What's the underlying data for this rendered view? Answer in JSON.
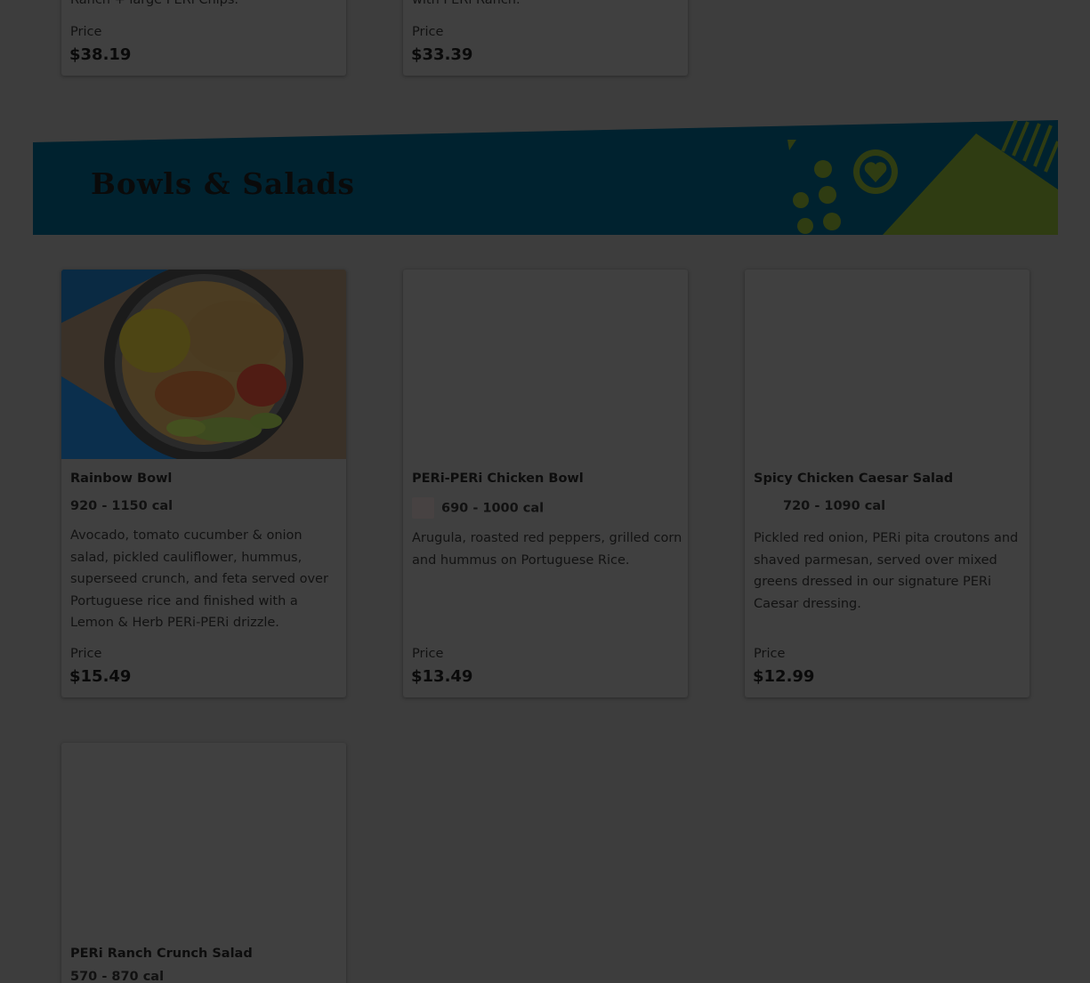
{
  "top_cards": [
    {
      "desc_tail": "Ranch + large PERi Chips.",
      "price_label": "Price",
      "price": "$38.19"
    },
    {
      "desc_tail": "with PERi Ranch.",
      "price_label": "Price",
      "price": "$33.39"
    }
  ],
  "section": {
    "title": "Bowls & Salads",
    "accent": "#00222f",
    "accent2": "#2f3c12"
  },
  "items": [
    {
      "name": "Rainbow Bowl",
      "calories": "920 - 1150 cal",
      "description": "Avocado, tomato cucumber & onion salad, pickled cauliflower, hummus, superseed crunch, and feta served over Portuguese rice and finished with a Lemon & Herb PERi-PERi drizzle.",
      "price_label": "Price",
      "price": "$15.49"
    },
    {
      "name": "PERi-PERi Chicken Bowl",
      "calories": "690 - 1000 cal",
      "description": "Arugula, roasted red peppers, grilled corn and hummus on Portuguese Rice.",
      "price_label": "Price",
      "price": "$13.49"
    },
    {
      "name": "Spicy Chicken Caesar Salad",
      "calories": "720 - 1090 cal",
      "description": "Pickled red onion, PERi pita croutons and shaved parmesan, served over mixed greens dressed in our signature PERi Caesar dressing.",
      "price_label": "Price",
      "price": "$12.99"
    },
    {
      "name": "PERi Ranch Crunch Salad",
      "calories": "570 - 870 cal"
    }
  ]
}
